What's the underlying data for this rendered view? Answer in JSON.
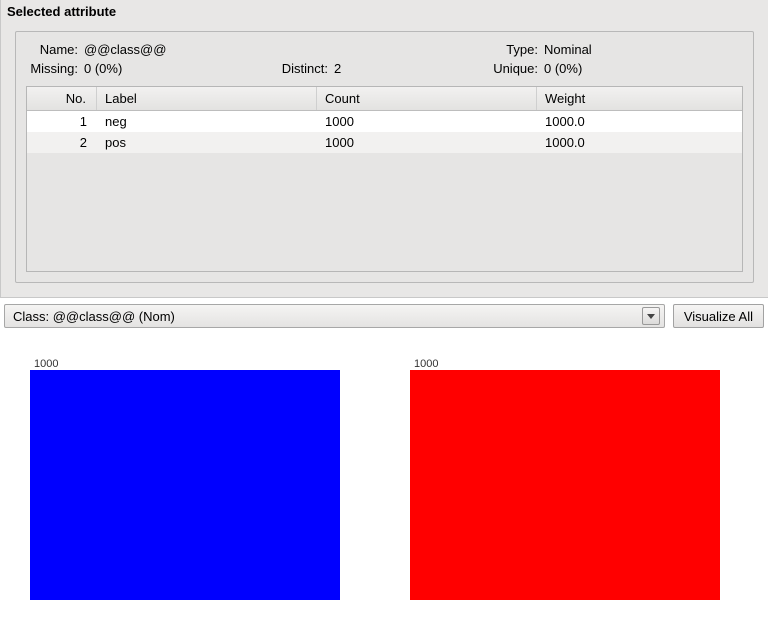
{
  "panel": {
    "title": "Selected attribute",
    "meta": {
      "name_label": "Name:",
      "name_value": "@@class@@",
      "type_label": "Type:",
      "type_value": "Nominal",
      "missing_label": "Missing:",
      "missing_value": "0 (0%)",
      "distinct_label": "Distinct:",
      "distinct_value": "2",
      "unique_label": "Unique:",
      "unique_value": "0 (0%)"
    },
    "table": {
      "columns": {
        "no": "No.",
        "label": "Label",
        "count": "Count",
        "weight": "Weight"
      },
      "rows": [
        {
          "no": "1",
          "label": "neg",
          "count": "1000",
          "weight": "1000.0"
        },
        {
          "no": "2",
          "label": "pos",
          "count": "1000",
          "weight": "1000.0"
        }
      ]
    }
  },
  "dropdown": {
    "label": "Class: @@class@@ (Nom)"
  },
  "visualize_button": "Visualize All",
  "chart_data": {
    "type": "bar",
    "categories": [
      "neg",
      "pos"
    ],
    "values": [
      1000,
      1000
    ],
    "colors": [
      "#0000ff",
      "#ff0000"
    ],
    "data_labels": [
      "1000",
      "1000"
    ],
    "ylim": [
      0,
      1000
    ]
  }
}
